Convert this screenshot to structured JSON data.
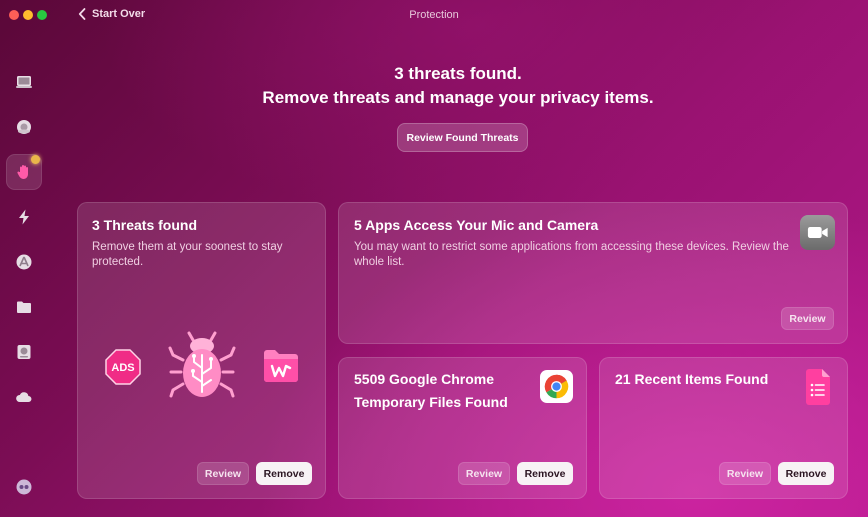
{
  "window": {
    "back_label": "Start Over",
    "title": "Protection"
  },
  "sidebar": {
    "items": [
      {
        "icon": "system-junk-icon"
      },
      {
        "icon": "malware-icon"
      },
      {
        "icon": "protection-hand-icon",
        "active": true
      },
      {
        "icon": "speed-bolt-icon"
      },
      {
        "icon": "applications-icon"
      },
      {
        "icon": "files-folder-icon"
      },
      {
        "icon": "disk-icon"
      },
      {
        "icon": "cloud-icon"
      },
      {
        "icon": "assistant-icon"
      }
    ]
  },
  "header": {
    "line1": "3 threats found.",
    "line2": "Remove threats and manage your privacy items.",
    "cta_label": "Review Found Threats"
  },
  "cards": {
    "threats": {
      "title": "3 Threats found",
      "description": "Remove them at your soonest to stay protected.",
      "icons": [
        "ads-icon",
        "bug-icon",
        "infected-folder-icon"
      ],
      "ads_text": "ADS",
      "review_label": "Review",
      "remove_label": "Remove"
    },
    "apps": {
      "title": "5 Apps Access Your Mic and Camera",
      "description": "You may want to restrict some applications from accessing these devices. Review the whole list.",
      "icon": "camera-icon",
      "review_label": "Review"
    },
    "chrome": {
      "title": "5509 Google Chrome Temporary Files Found",
      "icon": "chrome-icon",
      "review_label": "Review",
      "remove_label": "Remove"
    },
    "recent": {
      "title": "21 Recent Items Found",
      "icon": "document-icon",
      "review_label": "Review",
      "remove_label": "Remove"
    }
  },
  "colors": {
    "accent_pink": "#e0208f",
    "badge": "#e9b64a",
    "button_solid": "#f7f2f5"
  }
}
